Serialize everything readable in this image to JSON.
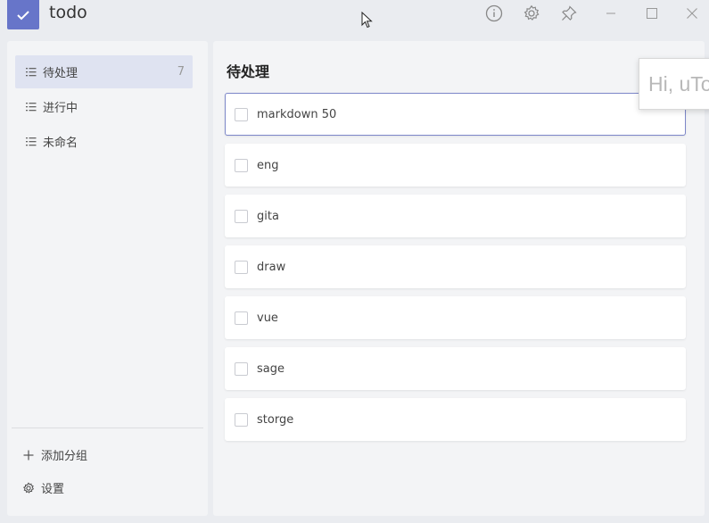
{
  "app": {
    "title": "todo"
  },
  "sidebar": {
    "items": [
      {
        "label": "待处理",
        "count": "7",
        "active": true
      },
      {
        "label": "进行中",
        "count": "",
        "active": false
      },
      {
        "label": "未命名",
        "count": "",
        "active": false
      }
    ],
    "add_group_label": "添加分组",
    "settings_label": "设置"
  },
  "main": {
    "title": "待处理",
    "tasks": [
      {
        "label": "markdown 50"
      },
      {
        "label": "eng"
      },
      {
        "label": "gita"
      },
      {
        "label": "draw"
      },
      {
        "label": "vue"
      },
      {
        "label": "sage"
      },
      {
        "label": "storge"
      }
    ]
  },
  "popup": {
    "text": "Hi, uTo"
  },
  "colors": {
    "accent": "#6775c9",
    "active_bg": "#dfe3f1",
    "focus_border": "#7d87c9"
  },
  "icons": [
    "check-icon",
    "info-icon",
    "gear-icon",
    "pin-icon",
    "minimize-icon",
    "maximize-icon",
    "close-icon",
    "list-icon",
    "plus-icon",
    "settings-icon",
    "cursor-icon"
  ]
}
